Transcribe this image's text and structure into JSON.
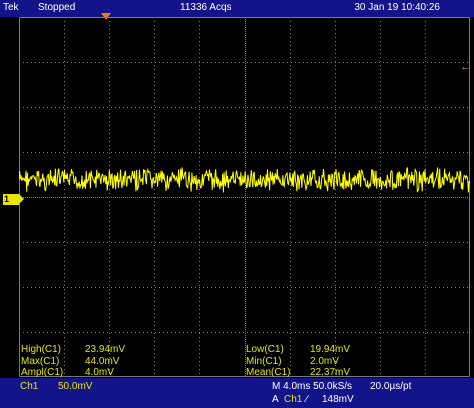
{
  "header": {
    "brand": "Tek",
    "run_state": "Stopped",
    "acquisitions": "11336 Acqs",
    "datetime": "30 Jan 19 10:40:26"
  },
  "screen": {
    "channel_marker": "1",
    "trigger_level_arrow": "←"
  },
  "measurements": [
    {
      "label": "High(C1)",
      "value": "23.94mV"
    },
    {
      "label": "Max(C1)",
      "value": "44.0mV"
    },
    {
      "label": "Ampl(C1)",
      "value": "4.0mV"
    },
    {
      "label": "Low(C1)",
      "value": "19.94mV"
    },
    {
      "label": "Min(C1)",
      "value": "2.0mV"
    },
    {
      "label": "Mean(C1)",
      "value": "22.37mV"
    }
  ],
  "status": {
    "channel": "Ch1",
    "volts_per_div": "50.0mV",
    "timebase": "M 4.0ms 50.0kS/s",
    "sample_interval": "20.0µs/pt",
    "trigger_mode": "A",
    "trigger_source": "Ch1",
    "trigger_slope": "∕",
    "trigger_level": "148mV"
  },
  "colors": {
    "background": "#000000",
    "trace": "#ffff00",
    "grid": "#7a7a7a",
    "bar": "#14148a",
    "trigger_marker": "#e07b2a"
  }
}
